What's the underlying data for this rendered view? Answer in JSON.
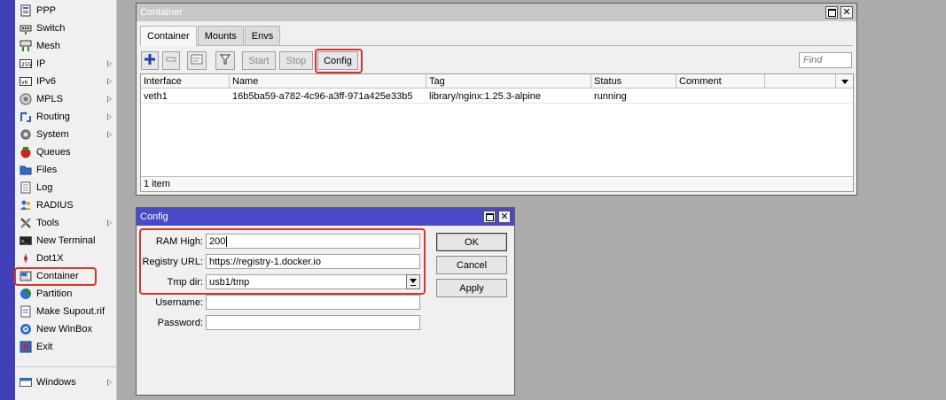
{
  "sidebar": {
    "items": [
      {
        "label": "PPP",
        "icon": "ppp-icon",
        "submenu": false
      },
      {
        "label": "Switch",
        "icon": "switch-icon",
        "submenu": false
      },
      {
        "label": "Mesh",
        "icon": "mesh-icon",
        "submenu": false
      },
      {
        "label": "IP",
        "icon": "ip-icon",
        "submenu": true
      },
      {
        "label": "IPv6",
        "icon": "ipv6-icon",
        "submenu": true
      },
      {
        "label": "MPLS",
        "icon": "mpls-icon",
        "submenu": true
      },
      {
        "label": "Routing",
        "icon": "routing-icon",
        "submenu": true
      },
      {
        "label": "System",
        "icon": "system-icon",
        "submenu": true
      },
      {
        "label": "Queues",
        "icon": "queues-icon",
        "submenu": false
      },
      {
        "label": "Files",
        "icon": "files-icon",
        "submenu": false
      },
      {
        "label": "Log",
        "icon": "log-icon",
        "submenu": false
      },
      {
        "label": "RADIUS",
        "icon": "radius-icon",
        "submenu": false
      },
      {
        "label": "Tools",
        "icon": "tools-icon",
        "submenu": true
      },
      {
        "label": "New Terminal",
        "icon": "terminal-icon",
        "submenu": false
      },
      {
        "label": "Dot1X",
        "icon": "dot1x-icon",
        "submenu": false
      },
      {
        "label": "Container",
        "icon": "container-icon",
        "submenu": false
      },
      {
        "label": "Partition",
        "icon": "partition-icon",
        "submenu": false
      },
      {
        "label": "Make Supout.rif",
        "icon": "supout-icon",
        "submenu": false
      },
      {
        "label": "New WinBox",
        "icon": "winbox-icon",
        "submenu": false
      },
      {
        "label": "Exit",
        "icon": "exit-icon",
        "submenu": false
      }
    ],
    "windows_item": {
      "label": "Windows",
      "icon": "windows-icon",
      "submenu": true
    }
  },
  "container_window": {
    "title": "Container",
    "tabs": [
      "Container",
      "Mounts",
      "Envs"
    ],
    "toolbar": {
      "start_label": "Start",
      "stop_label": "Stop",
      "config_label": "Config"
    },
    "find_placeholder": "Find",
    "columns": [
      "Interface",
      "Name",
      "Tag",
      "Status",
      "Comment"
    ],
    "rows": [
      {
        "interface": "veth1",
        "name": "16b5ba59-a782-4c96-a3ff-971a425e33b5",
        "tag": "library/nginx:1.25.3-alpine",
        "status": "running",
        "comment": ""
      }
    ],
    "status_text": "1 item"
  },
  "config_window": {
    "title": "Config",
    "fields": {
      "ram_high": {
        "label": "RAM High:",
        "value": "200"
      },
      "registry_url": {
        "label": "Registry URL:",
        "value": "https://registry-1.docker.io"
      },
      "tmp_dir": {
        "label": "Tmp dir:",
        "value": "usb1/tmp"
      },
      "username": {
        "label": "Username:",
        "value": ""
      },
      "password": {
        "label": "Password:",
        "value": ""
      }
    },
    "buttons": {
      "ok": "OK",
      "cancel": "Cancel",
      "apply": "Apply"
    }
  },
  "colors": {
    "sidebar_strip": "#4040b8",
    "desktop": "#ababab",
    "active_titlebar": "#4a4ac8",
    "inactive_titlebar": "#c8c8c8",
    "highlight": "#d9342b"
  }
}
